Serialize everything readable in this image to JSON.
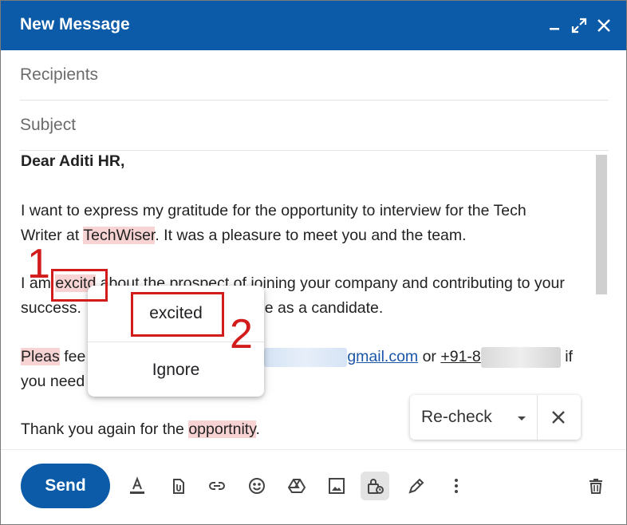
{
  "header": {
    "title": "New Message"
  },
  "fields": {
    "recipients_placeholder": "Recipients",
    "subject_placeholder": "Subject"
  },
  "body": {
    "greeting": "Dear Aditi HR,",
    "p1_line1": "I want to express my gratitude for the opportunity to interview for the Tech",
    "p1_line2_a": "Writer at ",
    "p1_line2_err": "TechWiser",
    "p1_line2_b": ". It was a pleasure to meet you and the team.",
    "p2_line1_a": "I am ",
    "p2_line1_err": "excitd",
    "p2_line1_b": " about the prospect of joining your company and contributing to your",
    "p2_line2_a": "success. ",
    "p2_line2_b": "g me as a candidate.",
    "p3_line1_err": "Pleas",
    "p3_line1_a": " fee",
    "p3_email_suffix": "gmail.com",
    "p3_or": " or ",
    "p3_phone_prefix": "+91-8",
    "p3_if": " if",
    "p3_line2": "you need",
    "p4_a": "Thank you again for the ",
    "p4_err": "opportnity",
    "p4_b": "."
  },
  "spell_popup": {
    "suggestion": "excited",
    "ignore": "Ignore"
  },
  "annotations": {
    "step1": "1",
    "step2": "2"
  },
  "recheck": {
    "label": "Re-check"
  },
  "toolbar": {
    "send_label": "Send",
    "icons": [
      "format-text-icon",
      "attach-icon",
      "link-icon",
      "emoji-icon",
      "drive-icon",
      "photo-icon",
      "confidential-lock-icon",
      "signature-pen-icon",
      "more-options-icon",
      "delete-icon"
    ]
  },
  "colors": {
    "header": "#0b5ba8",
    "error_highlight": "#f8d3d3",
    "annotation_red": "#d21c1c",
    "link": "#1a56a8"
  }
}
